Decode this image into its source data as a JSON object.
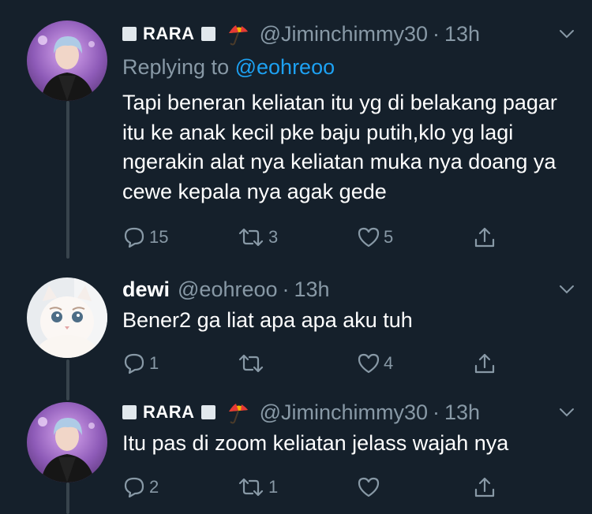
{
  "tweets": [
    {
      "display_name": "RARA",
      "handle": "@Jiminchimmy30",
      "separator": "·",
      "time": "13h",
      "replying_prefix": "Replying to",
      "replying_to": "@eohreoo",
      "text": "Tapi beneran keliatan itu yg di belakang pagar itu ke anak kecil pke baju putih,klo yg lagi ngerakin alat nya keliatan muka nya doang ya cewe kepala nya agak gede",
      "replies": "15",
      "retweets": "3",
      "likes": "5"
    },
    {
      "display_name": "dewi",
      "handle": "@eohreoo",
      "separator": "·",
      "time": "13h",
      "text": "Bener2 ga liat apa apa aku tuh",
      "replies": "1",
      "retweets": "",
      "likes": "4"
    },
    {
      "display_name": "RARA",
      "handle": "@Jiminchimmy30",
      "separator": "·",
      "time": "13h",
      "text": "Itu pas di zoom keliatan jelass wajah nya",
      "replies": "2",
      "retweets": "1",
      "likes": ""
    }
  ],
  "icons": {
    "reply": "reply-icon",
    "retweet": "retweet-icon",
    "like": "heart-icon",
    "share": "share-icon",
    "more": "chevron-down-icon",
    "emoji": "umbrella-emoji"
  },
  "colors": {
    "background": "#15202b",
    "primary_text": "#ffffff",
    "secondary_text": "#8899a6",
    "link": "#1da1f2",
    "thread_line": "#38444d"
  }
}
